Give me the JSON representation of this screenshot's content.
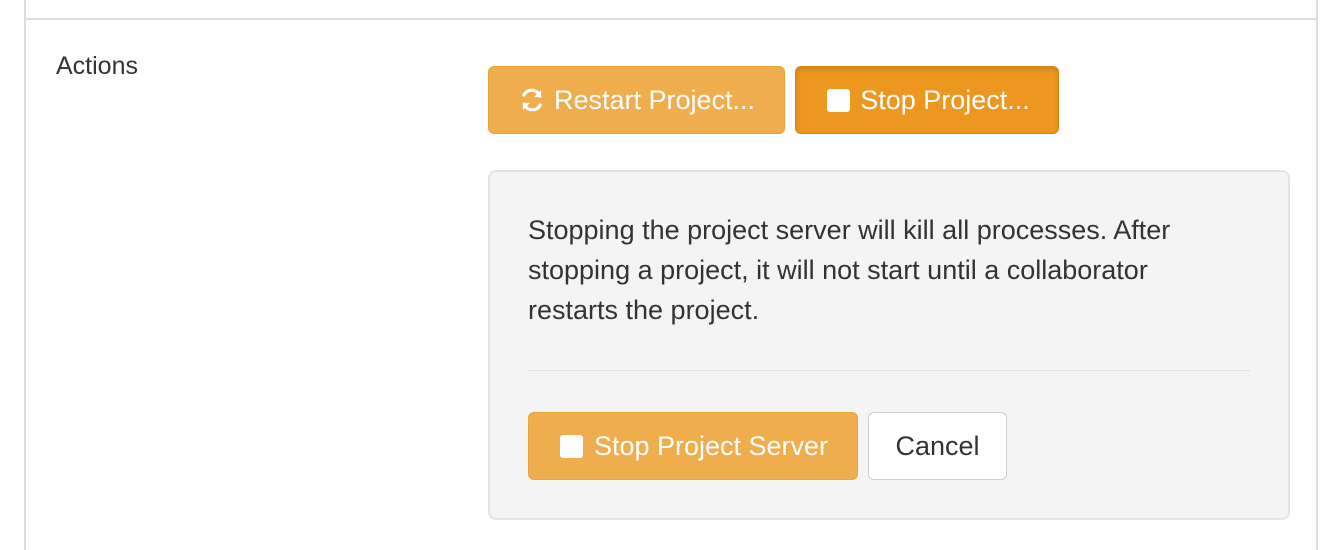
{
  "section": {
    "label": "Actions"
  },
  "actions": {
    "restart_label": "Restart Project...",
    "restart_icon": "refresh-icon",
    "stop_label": "Stop Project...",
    "stop_icon": "stop-icon"
  },
  "confirm": {
    "message": "Stopping the project server will kill all processes. After stopping a project, it will not start until a collaborator restarts the project.",
    "stop_server_label": "Stop Project Server",
    "stop_server_icon": "stop-icon",
    "cancel_label": "Cancel"
  },
  "colors": {
    "warning": "#f0ad4e",
    "warning_active": "#ec971f",
    "text": "#333333",
    "well_background": "#f4f4f4"
  }
}
